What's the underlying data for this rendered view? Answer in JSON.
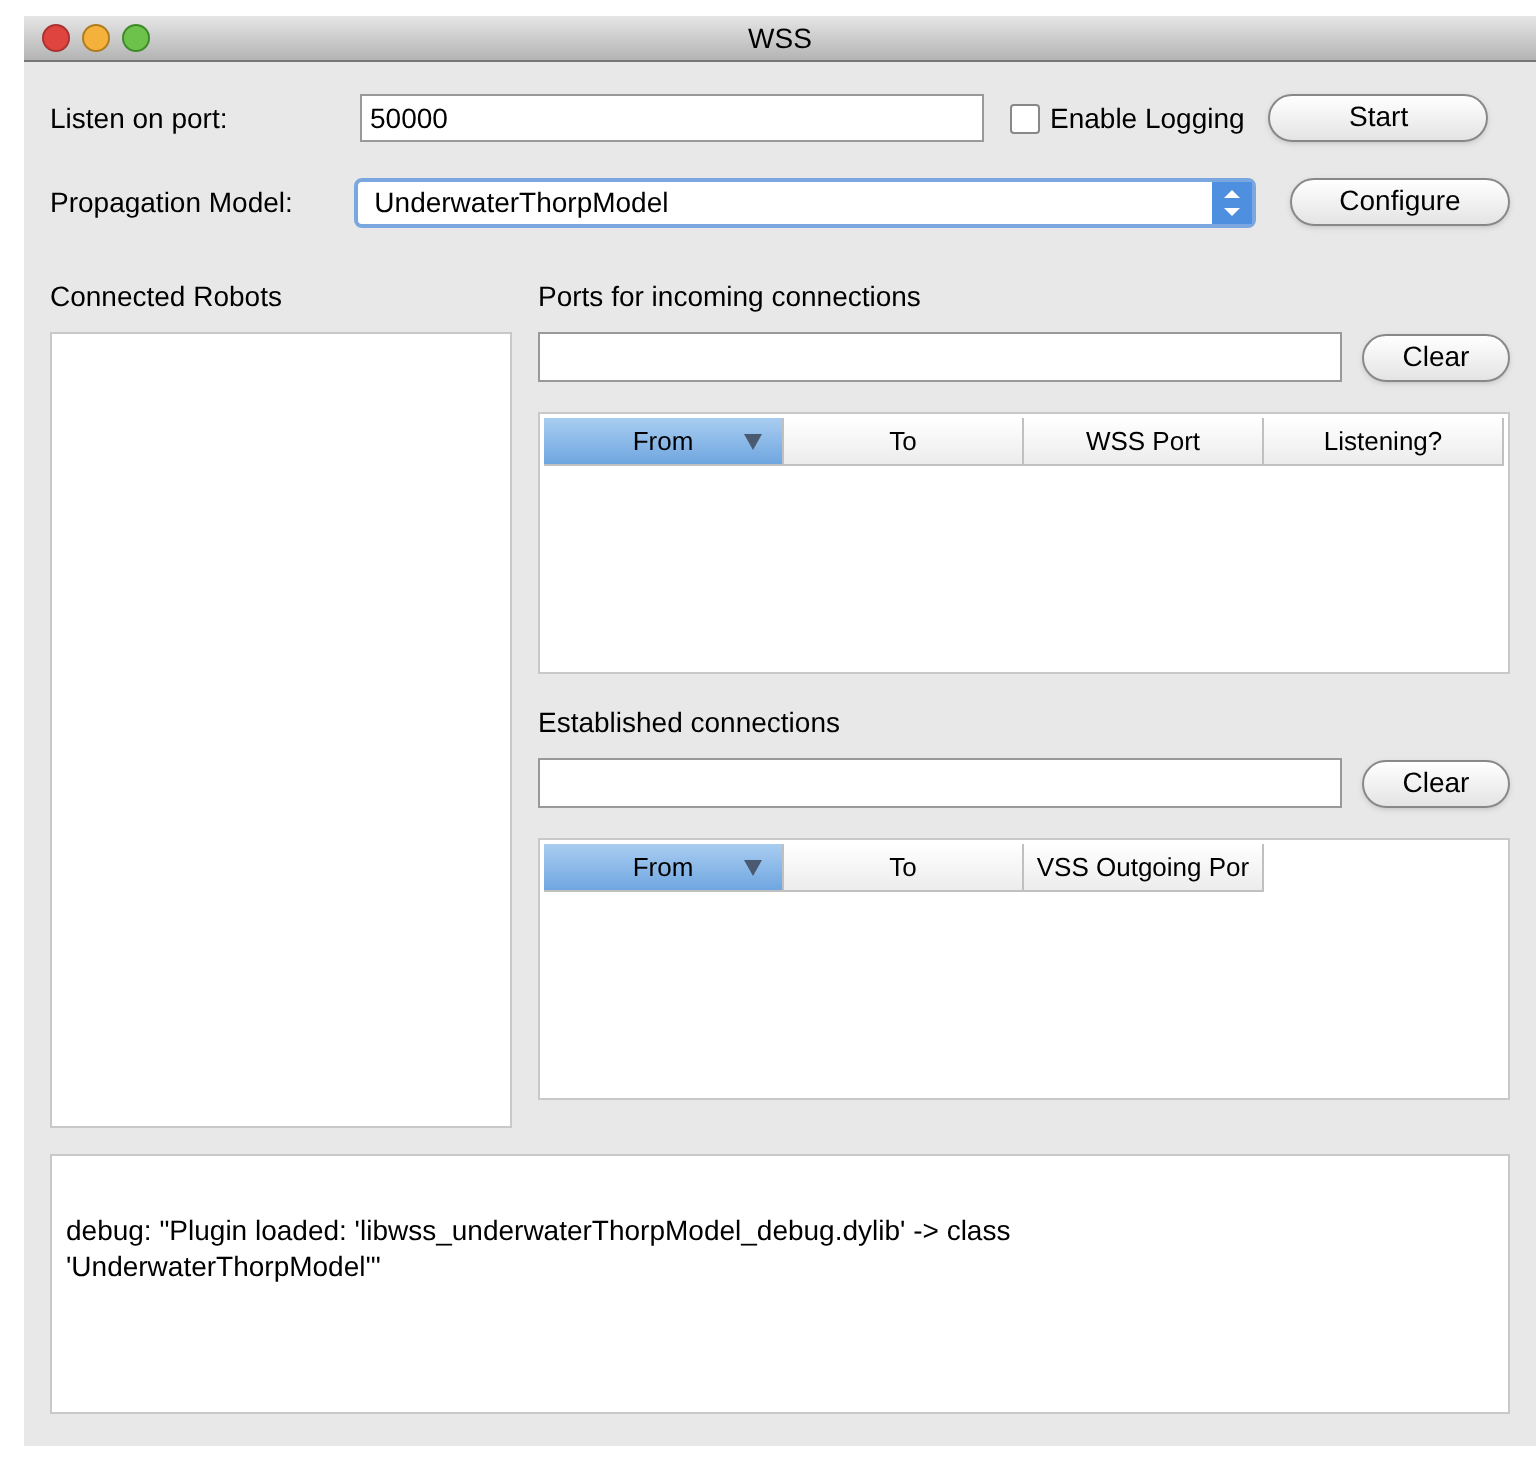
{
  "window": {
    "title": "WSS"
  },
  "port": {
    "label": "Listen on port:",
    "value": "50000"
  },
  "logging": {
    "label": "Enable Logging",
    "checked": false
  },
  "start_button": "Start",
  "model": {
    "label": "Propagation Model:",
    "value": "UnderwaterThorpModel"
  },
  "configure_button": "Configure",
  "robots": {
    "title": "Connected Robots"
  },
  "incoming": {
    "title": "Ports for incoming connections",
    "clear_button": "Clear",
    "columns": [
      {
        "label": "From",
        "selected": true
      },
      {
        "label": "To",
        "selected": false
      },
      {
        "label": "WSS Port",
        "selected": false
      },
      {
        "label": "Listening?",
        "selected": false
      }
    ]
  },
  "established": {
    "title": "Established connections",
    "clear_button": "Clear",
    "columns": [
      {
        "label": "From",
        "selected": true
      },
      {
        "label": "To",
        "selected": false
      },
      {
        "label": "VSS Outgoing Por",
        "selected": false
      }
    ]
  },
  "log": "debug: \"Plugin loaded: 'libwss_underwaterThorpModel_debug.dylib' -> class\n'UnderwaterThorpModel'\""
}
